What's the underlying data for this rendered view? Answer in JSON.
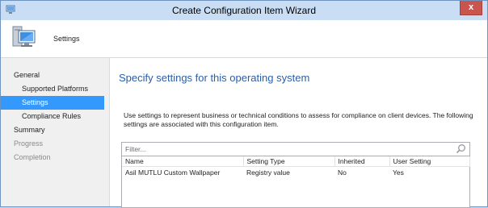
{
  "window": {
    "title": "Create Configuration Item Wizard",
    "close_label": "x"
  },
  "header": {
    "title": "Settings",
    "icon": "computer-monitor-icon"
  },
  "sidebar": {
    "items": [
      {
        "label": "General",
        "state": "normal"
      },
      {
        "label": "Supported Platforms",
        "state": "normal"
      },
      {
        "label": "Settings",
        "state": "selected"
      },
      {
        "label": "Compliance Rules",
        "state": "normal"
      },
      {
        "label": "Summary",
        "state": "normal"
      },
      {
        "label": "Progress",
        "state": "disabled"
      },
      {
        "label": "Completion",
        "state": "disabled"
      }
    ]
  },
  "main": {
    "heading": "Specify settings for this operating system",
    "description": "Use settings to represent business or technical conditions to assess for compliance on client devices. The following settings are associated with this configuration item.",
    "filter": {
      "placeholder": "Filter...",
      "value": ""
    },
    "table": {
      "columns": [
        "Name",
        "Setting Type",
        "Inherited",
        "User Setting"
      ],
      "rows": [
        {
          "name": "Asil MUTLU Custom Wallpaper",
          "setting_type": "Registry value",
          "inherited": "No",
          "user_setting": "Yes"
        }
      ]
    }
  },
  "colors": {
    "accent": "#3399ff",
    "heading": "#2a5ea8",
    "titlebar": "#c9def4",
    "close": "#c9554f"
  }
}
